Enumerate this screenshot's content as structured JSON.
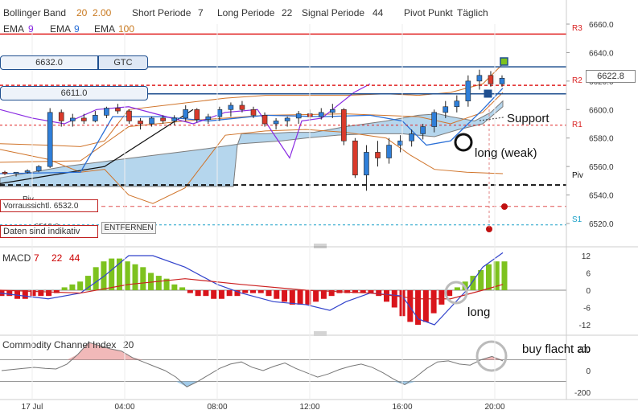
{
  "header": {
    "bollinger": {
      "label": "Bollinger Band",
      "p1": "20",
      "p2": "2.00"
    },
    "short": {
      "label": "Short Periode",
      "value": "7"
    },
    "long": {
      "label": "Long Periode",
      "value": "22"
    },
    "signal": {
      "label": "Signal Periode",
      "value": "44"
    },
    "pivot": {
      "label": "Pivot Punkt",
      "value": "Täglich"
    },
    "ema1": {
      "label": "EMA",
      "value": "9"
    },
    "ema2": {
      "label": "EMA",
      "value": "9"
    },
    "ema3": {
      "label": "EMA",
      "value": "100"
    }
  },
  "order_boxes": {
    "order1_price": "6632.0",
    "order1_type": "GTC",
    "order2_price": "6611.0",
    "forecast": "Vorraussichtl. 6532.0",
    "data_hint": "Daten sind indikativ",
    "remove_button": "ENTFERNEN",
    "partial_price": "6518.0"
  },
  "annotations": {
    "support": "Support",
    "long_weak": "long (weak)",
    "macd_long": "long",
    "cci_note": "buy flacht ab"
  },
  "pivot_labels": {
    "r3": "R3",
    "r2": "R2",
    "r1": "R1",
    "piv": "Piv",
    "s1": "S1",
    "piv_left": "Piv"
  },
  "last_price": "6622.8",
  "main_ticks": [
    "6660.0",
    "6640.0",
    "6620.0",
    "6600.0",
    "6580.0",
    "6560.0",
    "6540.0",
    "6520.0"
  ],
  "macd_panel": {
    "label": "MACD",
    "p1": "7",
    "p2": "22",
    "p3": "44",
    "ticks": [
      "12",
      "6",
      "0",
      "-6",
      "-12"
    ]
  },
  "cci_panel": {
    "label": "Commodity Channel Index",
    "period": "20",
    "ticks": [
      "200",
      "0",
      "-200"
    ]
  },
  "x_ticks": [
    "17 Jul",
    "04:00",
    "08:00",
    "12:00",
    "16:00",
    "20:00"
  ],
  "colors": {
    "up": "#2f7fd9",
    "down": "#d93a2b",
    "macd_pos": "#7dc21e",
    "macd_neg": "#d9141b",
    "cloud": "#7ab5e0",
    "r_line": "#e02020",
    "order_line": "#1f4f8f",
    "ema": "#2a6fd6",
    "bb": "#d0742a",
    "signal": "#8a2be2"
  },
  "chart_data": [
    {
      "type": "candlestick",
      "ylim": [
        6512,
        6668
      ],
      "levels": {
        "R3": 6653,
        "R2": 6617,
        "R1": 6589,
        "Piv": 6547,
        "S1": 6519,
        "order_gtc": 6630,
        "order": 6611
      },
      "times": [
        "01:00",
        "01:30",
        "02:00",
        "02:30",
        "03:00",
        "03:30",
        "04:00",
        "04:30",
        "05:00",
        "05:30",
        "06:00",
        "06:30",
        "07:00",
        "07:30",
        "08:00",
        "08:30",
        "09:00",
        "09:30",
        "10:00",
        "10:30",
        "11:00",
        "11:30",
        "12:00",
        "12:30",
        "13:00",
        "13:30",
        "14:00",
        "14:30",
        "15:00",
        "15:30",
        "16:00",
        "16:15",
        "16:30",
        "16:45",
        "17:00",
        "17:15",
        "17:30",
        "17:45",
        "18:00",
        "18:30",
        "19:00",
        "19:15",
        "19:30",
        "19:45",
        "20:00"
      ],
      "ohlc": [
        [
          6556,
          6557,
          6554,
          6555
        ],
        [
          6555,
          6556,
          6553,
          6556
        ],
        [
          6556,
          6558,
          6555,
          6557
        ],
        [
          6557,
          6561,
          6556,
          6560
        ],
        [
          6560,
          6601,
          6559,
          6598
        ],
        [
          6598,
          6600,
          6588,
          6592
        ],
        [
          6592,
          6597,
          6588,
          6594
        ],
        [
          6594,
          6597,
          6590,
          6592
        ],
        [
          6592,
          6599,
          6591,
          6596
        ],
        [
          6596,
          6602,
          6594,
          6601
        ],
        [
          6601,
          6604,
          6597,
          6599
        ],
        [
          6599,
          6600,
          6590,
          6592
        ],
        [
          6592,
          6594,
          6586,
          6590
        ],
        [
          6590,
          6595,
          6588,
          6594
        ],
        [
          6594,
          6596,
          6590,
          6592
        ],
        [
          6592,
          6596,
          6589,
          6594
        ],
        [
          6594,
          6603,
          6592,
          6600
        ],
        [
          6600,
          6601,
          6591,
          6593
        ],
        [
          6593,
          6597,
          6590,
          6595
        ],
        [
          6595,
          6602,
          6592,
          6600
        ],
        [
          6600,
          6605,
          6595,
          6603
        ],
        [
          6603,
          6606,
          6598,
          6600
        ],
        [
          6600,
          6602,
          6594,
          6596
        ],
        [
          6596,
          6598,
          6588,
          6590
        ],
        [
          6590,
          6594,
          6586,
          6592
        ],
        [
          6592,
          6595,
          6588,
          6594
        ],
        [
          6594,
          6599,
          6590,
          6597
        ],
        [
          6597,
          6600,
          6592,
          6595
        ],
        [
          6595,
          6601,
          6593,
          6598
        ],
        [
          6598,
          6604,
          6594,
          6600
        ],
        [
          6600,
          6601,
          6575,
          6578
        ],
        [
          6578,
          6580,
          6552,
          6554
        ],
        [
          6554,
          6575,
          6543,
          6570
        ],
        [
          6570,
          6578,
          6560,
          6566
        ],
        [
          6566,
          6580,
          6562,
          6575
        ],
        [
          6575,
          6582,
          6570,
          6578
        ],
        [
          6578,
          6586,
          6574,
          6583
        ],
        [
          6583,
          6590,
          6579,
          6588
        ],
        [
          6588,
          6600,
          6584,
          6598
        ],
        [
          6598,
          6606,
          6594,
          6602
        ],
        [
          6602,
          6610,
          6598,
          6606
        ],
        [
          6606,
          6624,
          6602,
          6620
        ],
        [
          6620,
          6628,
          6614,
          6624
        ],
        [
          6624,
          6627,
          6616,
          6618
        ],
        [
          6618,
          6624,
          6616,
          6622
        ]
      ]
    },
    {
      "type": "bar",
      "title": "MACD 7 22 44",
      "ylim": [
        -14,
        14
      ],
      "values": [
        -2,
        -2,
        -3,
        -3,
        -2,
        -2,
        -2,
        -1,
        1,
        2,
        3,
        5,
        8,
        10,
        11,
        11,
        10,
        9,
        8,
        6,
        5,
        4,
        2,
        1,
        -1,
        -2,
        -2,
        -3,
        -3,
        -2,
        -2,
        -1,
        -1,
        -1,
        -2,
        -3,
        -4,
        -5,
        -5,
        -5,
        -4,
        -3,
        -2,
        -1,
        -1,
        -1,
        -1,
        -1,
        -2,
        -4,
        -6,
        -9,
        -11,
        -12,
        -11,
        -8,
        -5,
        -2,
        1,
        3,
        5,
        7,
        9,
        10,
        10
      ]
    },
    {
      "type": "area",
      "title": "Commodity Channel Index 20",
      "ylim": [
        -240,
        240
      ],
      "values": [
        0,
        10,
        20,
        30,
        20,
        15,
        60,
        150,
        260,
        230,
        200,
        180,
        120,
        80,
        40,
        0,
        -60,
        -150,
        -100,
        -40,
        20,
        60,
        80,
        30,
        0,
        40,
        70,
        20,
        -20,
        -60,
        -30,
        10,
        40,
        60,
        30,
        -20,
        -80,
        -130,
        -60,
        20,
        80,
        90,
        60,
        50,
        100,
        130,
        90
      ]
    }
  ]
}
